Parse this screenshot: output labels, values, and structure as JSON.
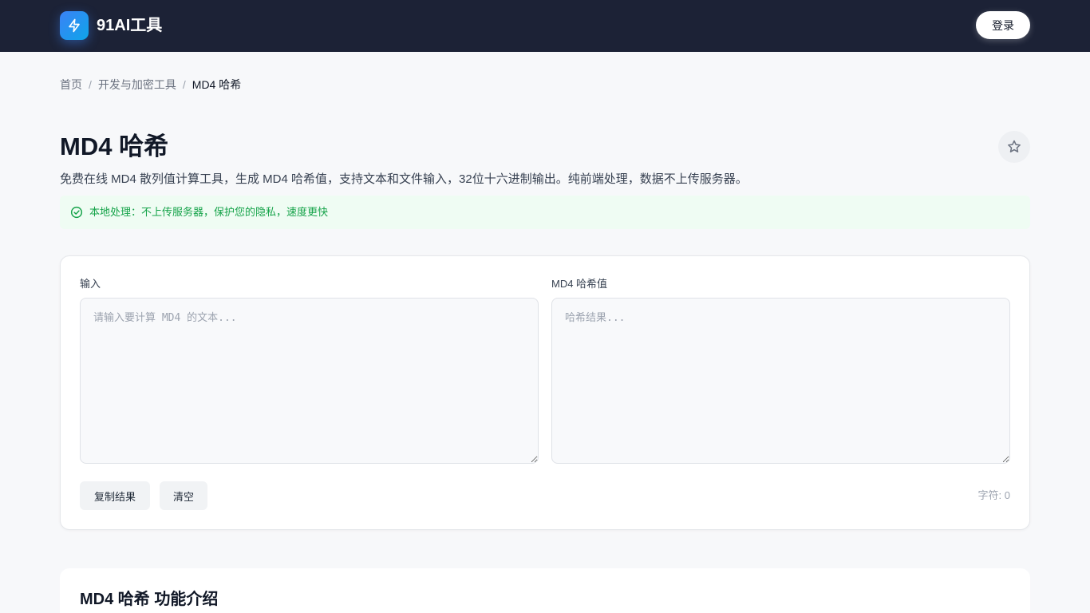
{
  "header": {
    "brand": "91AI工具",
    "login_label": "登录",
    "logo_icon": "lightning-bolt-icon",
    "accent": "#3b82f6",
    "background": "#1c2236"
  },
  "breadcrumb": {
    "home": "首页",
    "category": "开发与加密工具",
    "current": "MD4 哈希",
    "separator": "/"
  },
  "page": {
    "title": "MD4 哈希",
    "description": "免费在线 MD4 散列值计算工具，生成 MD4 哈希值，支持文本和文件输入，32位十六进制输出。纯前端处理，数据不上传服务器。",
    "favorite_icon": "star-outline-icon"
  },
  "notice": {
    "icon": "check-circle-icon",
    "text": "本地处理：不上传服务器，保护您的隐私，速度更快",
    "color": "#16a34a"
  },
  "tool": {
    "input_label": "输入",
    "input_placeholder": "请输入要计算 MD4 的文本...",
    "input_value": "",
    "output_label": "MD4 哈希值",
    "output_placeholder": "哈希结果...",
    "output_value": "",
    "copy_label": "复制结果",
    "clear_label": "清空",
    "char_count": "字符: 0"
  },
  "intro": {
    "title": "MD4 哈希 功能介绍"
  }
}
